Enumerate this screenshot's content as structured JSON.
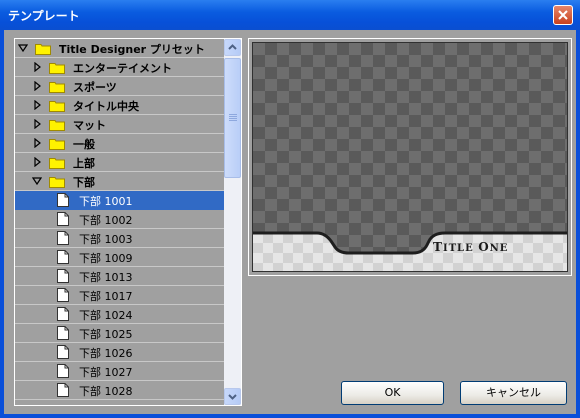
{
  "window": {
    "title": "テンプレート"
  },
  "tree": {
    "root": {
      "label": "Title Designer プリセット"
    },
    "folders": [
      {
        "label": "エンターテイメント"
      },
      {
        "label": "スポーツ"
      },
      {
        "label": "タイトル中央"
      },
      {
        "label": "マット"
      },
      {
        "label": "一般"
      },
      {
        "label": "上部"
      },
      {
        "label": "下部"
      }
    ],
    "items": [
      {
        "label": "下部 1001",
        "selected": true
      },
      {
        "label": "下部 1002"
      },
      {
        "label": "下部 1003"
      },
      {
        "label": "下部 1009"
      },
      {
        "label": "下部 1013"
      },
      {
        "label": "下部 1017"
      },
      {
        "label": "下部 1024"
      },
      {
        "label": "下部 1025"
      },
      {
        "label": "下部 1026"
      },
      {
        "label": "下部 1027"
      },
      {
        "label": "下部 1028"
      }
    ]
  },
  "preview": {
    "title_big_1": "T",
    "title_small_1": "ITLE ",
    "title_big_2": "O",
    "title_small_2": "NE"
  },
  "buttons": {
    "ok": "OK",
    "cancel": "キャンセル"
  },
  "colors": {
    "selection": "#316ac5",
    "panel": "#a0a0a0",
    "titlebar": "#0a5ce0"
  }
}
